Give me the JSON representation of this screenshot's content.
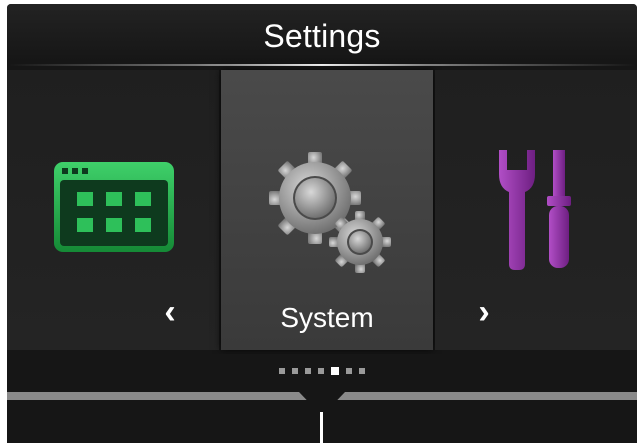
{
  "header": {
    "title": "Settings"
  },
  "carousel": {
    "items": [
      {
        "icon": "app-grid-icon",
        "color": "#22b04a"
      },
      {
        "icon": "gears-icon",
        "label": "System",
        "color": "#9a9a9a"
      },
      {
        "icon": "tools-icon",
        "color": "#8e2fa0"
      }
    ],
    "prev_arrow": "‹",
    "next_arrow": "›"
  },
  "pager": {
    "total": 7,
    "active_index": 4
  }
}
